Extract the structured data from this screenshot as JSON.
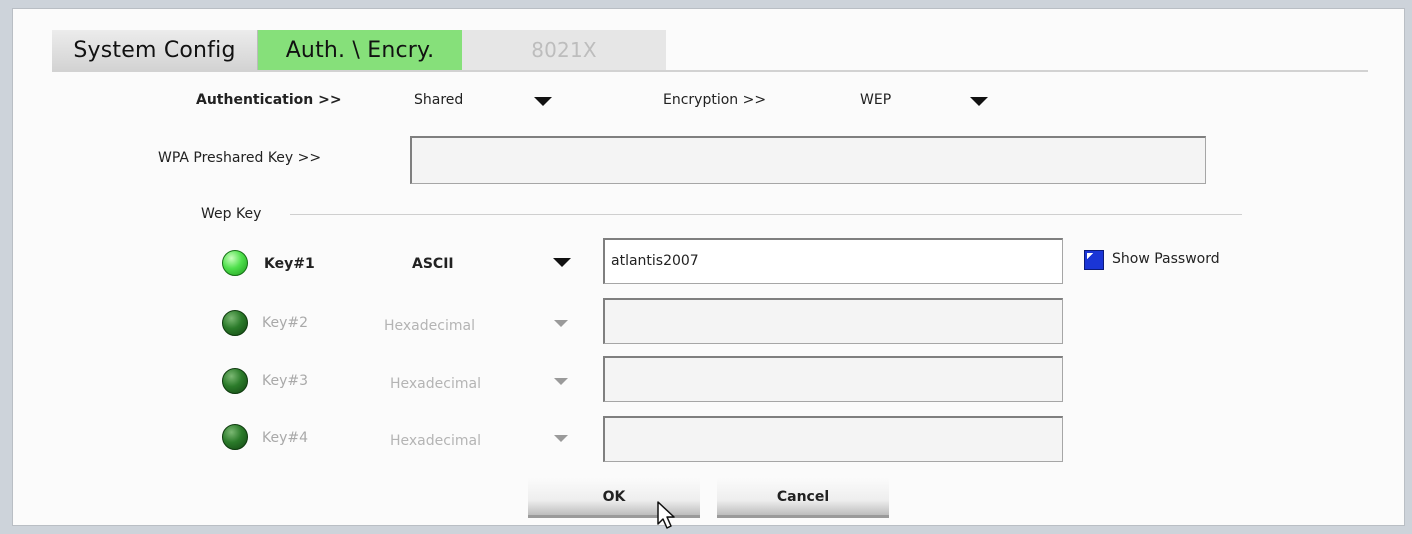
{
  "tabs": {
    "system_config": "System Config",
    "auth_encry": "Auth. \\ Encry.",
    "x8021": "8021X"
  },
  "authentication": {
    "label": "Authentication >>",
    "value": "Shared"
  },
  "encryption": {
    "label": "Encryption >>",
    "value": "WEP"
  },
  "wpa": {
    "label": "WPA Preshared Key >>",
    "value": ""
  },
  "wep": {
    "group_label": "Wep Key",
    "keys": [
      {
        "label": "Key#1",
        "type": "ASCII",
        "value": "atlantis2007",
        "active": true
      },
      {
        "label": "Key#2",
        "type": "Hexadecimal",
        "value": "",
        "active": false
      },
      {
        "label": "Key#3",
        "type": "Hexadecimal",
        "value": "",
        "active": false
      },
      {
        "label": "Key#4",
        "type": "Hexadecimal",
        "value": "",
        "active": false
      }
    ]
  },
  "show_password": {
    "label": "Show Password",
    "checked": true
  },
  "buttons": {
    "ok": "OK",
    "cancel": "Cancel"
  },
  "colors": {
    "active_tab": "#86e07a",
    "led_on": "#4fe04c",
    "led_off": "#2b7b2a",
    "checkbox": "#1a35d6"
  }
}
